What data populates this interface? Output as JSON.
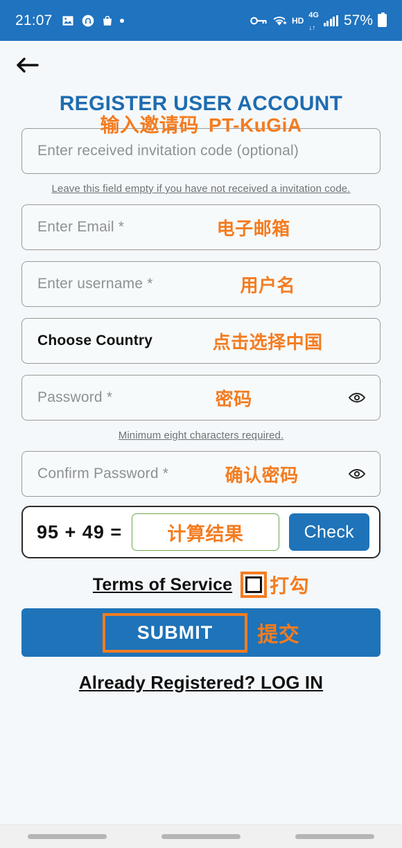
{
  "status_bar": {
    "time": "21:07",
    "left_icons": [
      "image-icon",
      "headphones-icon",
      "shopping-bag-icon",
      "dot-icon"
    ],
    "right_icons": [
      "vpn-key-icon",
      "wifi-icon",
      "hd-icon",
      "mobile-data-4g-icon",
      "signal-bars-icon"
    ],
    "hd_label": "HD",
    "network_label": "4G",
    "battery_percent": "57%",
    "background_color": "#1f73bf"
  },
  "nav": {
    "back_label": "back-arrow"
  },
  "page": {
    "title": "REGISTER USER ACCOUNT",
    "title_color": "#1e6cb0",
    "background_color": "#f5f8fa",
    "accent_orange": "#f47c20"
  },
  "form": {
    "invitation": {
      "placeholder": "Enter received invitation code (optional)",
      "overlay_cn": "输入邀请码",
      "overlay_code": "PT-KuGiA",
      "hint": "Leave this field empty if you have not received a invitation code."
    },
    "email": {
      "placeholder": "Enter Email *",
      "overlay_cn": "电子邮箱"
    },
    "username": {
      "placeholder": "Enter username *",
      "overlay_cn": "用户名"
    },
    "country": {
      "value": "Choose Country",
      "overlay_cn": "点击选择中国"
    },
    "password": {
      "placeholder": "Password *",
      "overlay_cn": "密码",
      "hint": "Minimum eight characters required.",
      "toggle_icon": "eye-icon"
    },
    "confirm_password": {
      "placeholder": "Confirm Password *",
      "overlay_cn": "确认密码",
      "toggle_icon": "eye-icon"
    },
    "captcha": {
      "question": "95 + 49 =",
      "operand_a": 95,
      "operand_b": 49,
      "answer_overlay_cn": "计算结果",
      "check_label": "Check"
    },
    "terms": {
      "link_label": "Terms of Service",
      "overlay_cn": "打勾",
      "checked": false
    },
    "submit": {
      "label": "SUBMIT",
      "overlay_cn": "提交"
    },
    "login": {
      "label": "Already Registered? LOG IN"
    }
  }
}
